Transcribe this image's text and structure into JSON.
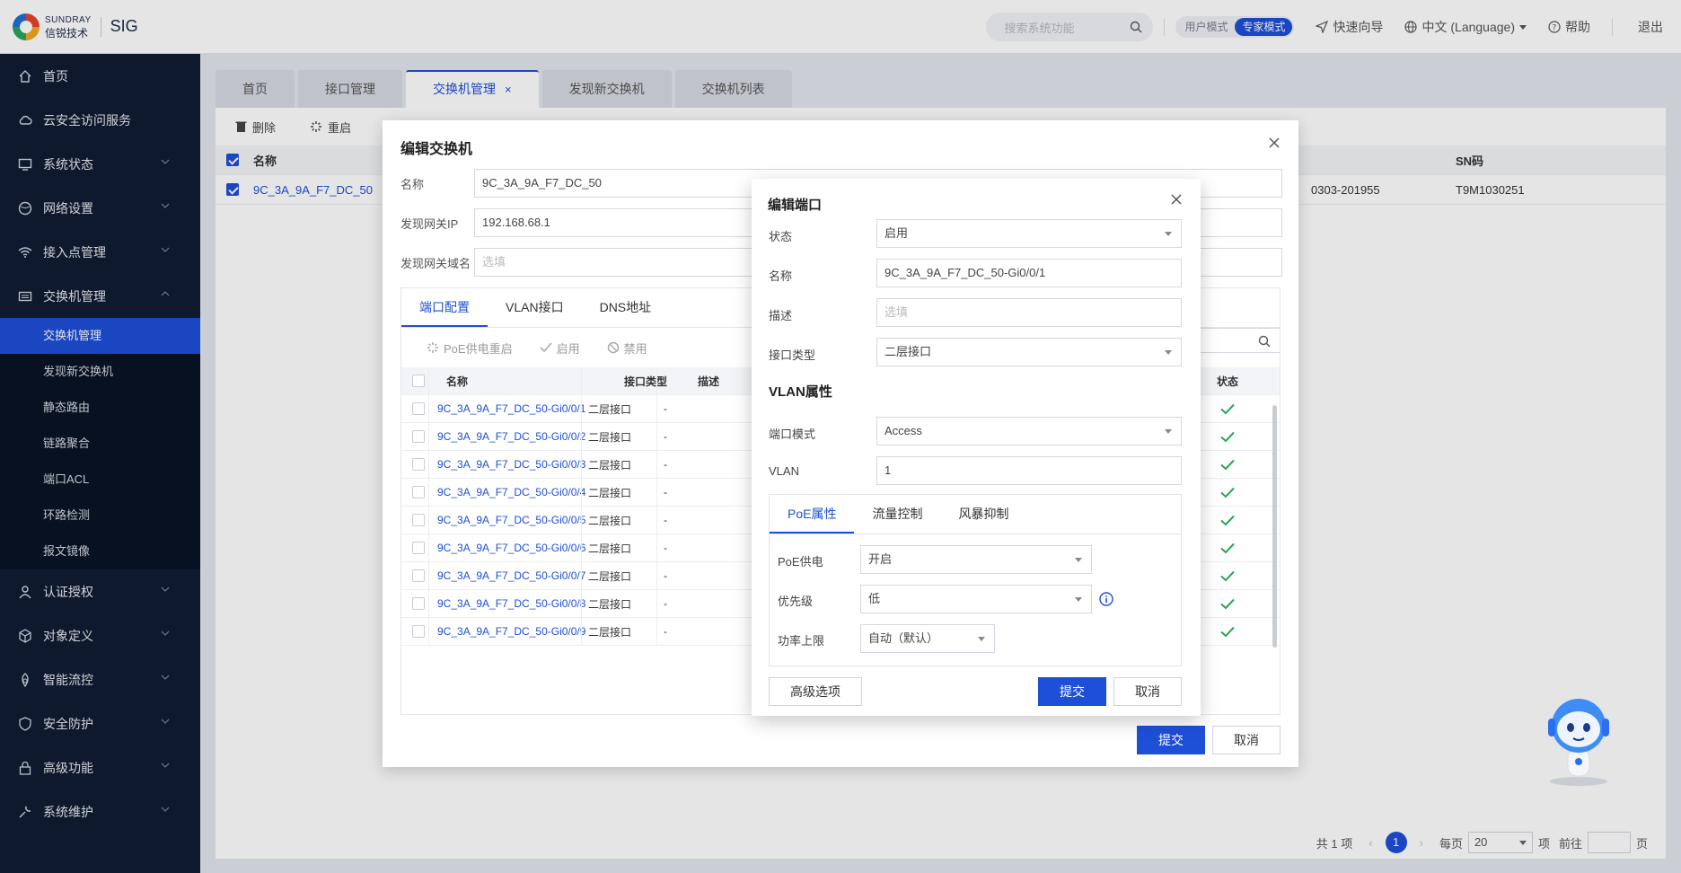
{
  "header": {
    "brand_en": "SUNDRAY",
    "brand_cn": "信锐技术",
    "product": "SIG",
    "search_placeholder": "搜索系统功能",
    "mode_user": "用户模式",
    "mode_expert": "专家模式",
    "quick_guide": "快速向导",
    "language": "中文 (Language)",
    "help": "帮助",
    "logout": "退出"
  },
  "sidebar": {
    "items": [
      {
        "label": "首页",
        "icon": "home-icon"
      },
      {
        "label": "云安全访问服务",
        "icon": "cloud-icon"
      },
      {
        "label": "系统状态",
        "icon": "monitor-icon"
      },
      {
        "label": "网络设置",
        "icon": "globe-icon"
      },
      {
        "label": "接入点管理",
        "icon": "wifi-icon"
      },
      {
        "label": "交换机管理",
        "icon": "switch-icon"
      }
    ],
    "sub": [
      "交换机管理",
      "发现新交换机",
      "静态路由",
      "链路聚合",
      "端口ACL",
      "环路检测",
      "报文镜像"
    ],
    "items2": [
      {
        "label": "认证授权",
        "icon": "user-icon"
      },
      {
        "label": "对象定义",
        "icon": "cube-icon"
      },
      {
        "label": "智能流控",
        "icon": "flow-icon"
      },
      {
        "label": "安全防护",
        "icon": "shield-icon"
      },
      {
        "label": "高级功能",
        "icon": "lock-icon"
      },
      {
        "label": "系统维护",
        "icon": "wrench-icon"
      }
    ]
  },
  "tabs": [
    "首页",
    "接口管理",
    "交换机管理",
    "发现新交换机",
    "交换机列表"
  ],
  "toolbar": {
    "delete": "删除",
    "restart": "重启"
  },
  "bg_table": {
    "col_name": "名称",
    "col_sn": "SN码",
    "row_name": "9C_3A_9A_F7_DC_50",
    "row_mid": "0303-201955",
    "row_sn": "T9M1030251"
  },
  "pager": {
    "total": "共 1 项",
    "page": "1",
    "per_page": "每页",
    "per_value": "20",
    "unit": "项",
    "goto": "前往",
    "page_unit": "页"
  },
  "dlg1": {
    "title": "编辑交换机",
    "name_label": "名称",
    "name_value": "9C_3A_9A_F7_DC_50",
    "ip_label": "发现网关IP",
    "ip_value": "192.168.68.1",
    "domain_label": "发现网关域名",
    "domain_placeholder": "选填",
    "tabs": [
      "端口配置",
      "VLAN接口",
      "DNS地址"
    ],
    "tools": {
      "poe_restart": "PoE供电重启",
      "enable": "启用",
      "disable": "禁用"
    },
    "cols": {
      "name": "名称",
      "type": "接口类型",
      "desc": "描述",
      "status": "状态"
    },
    "rows": [
      {
        "name": "9C_3A_9A_F7_DC_50-Gi0/0/1",
        "type": "二层接口",
        "desc": "-"
      },
      {
        "name": "9C_3A_9A_F7_DC_50-Gi0/0/2",
        "type": "二层接口",
        "desc": "-"
      },
      {
        "name": "9C_3A_9A_F7_DC_50-Gi0/0/3",
        "type": "二层接口",
        "desc": "-"
      },
      {
        "name": "9C_3A_9A_F7_DC_50-Gi0/0/4",
        "type": "二层接口",
        "desc": "-"
      },
      {
        "name": "9C_3A_9A_F7_DC_50-Gi0/0/5",
        "type": "二层接口",
        "desc": "-"
      },
      {
        "name": "9C_3A_9A_F7_DC_50-Gi0/0/6",
        "type": "二层接口",
        "desc": "-"
      },
      {
        "name": "9C_3A_9A_F7_DC_50-Gi0/0/7",
        "type": "二层接口",
        "desc": "-"
      },
      {
        "name": "9C_3A_9A_F7_DC_50-Gi0/0/8",
        "type": "二层接口",
        "desc": "-"
      },
      {
        "name": "9C_3A_9A_F7_DC_50-Gi0/0/9",
        "type": "二层接口",
        "desc": "-"
      }
    ],
    "submit": "提交",
    "cancel": "取消"
  },
  "dlg2": {
    "title": "编辑端口",
    "status_label": "状态",
    "status_value": "启用",
    "name_label": "名称",
    "name_value": "9C_3A_9A_F7_DC_50-Gi0/0/1",
    "desc_label": "描述",
    "desc_placeholder": "选填",
    "type_label": "接口类型",
    "type_value": "二层接口",
    "vlan_section": "VLAN属性",
    "mode_label": "端口模式",
    "mode_value": "Access",
    "vlan_label": "VLAN",
    "vlan_value": "1",
    "ptabs": [
      "PoE属性",
      "流量控制",
      "风暴抑制"
    ],
    "poe_label": "PoE供电",
    "poe_value": "开启",
    "prio_label": "优先级",
    "prio_value": "低",
    "power_label": "功率上限",
    "power_value": "自动（默认）",
    "advanced": "高级选项",
    "submit": "提交",
    "cancel": "取消"
  },
  "colors": {
    "accent": "#1e4fd8",
    "sidebar": "#111c33",
    "check": "#2aa55a"
  }
}
